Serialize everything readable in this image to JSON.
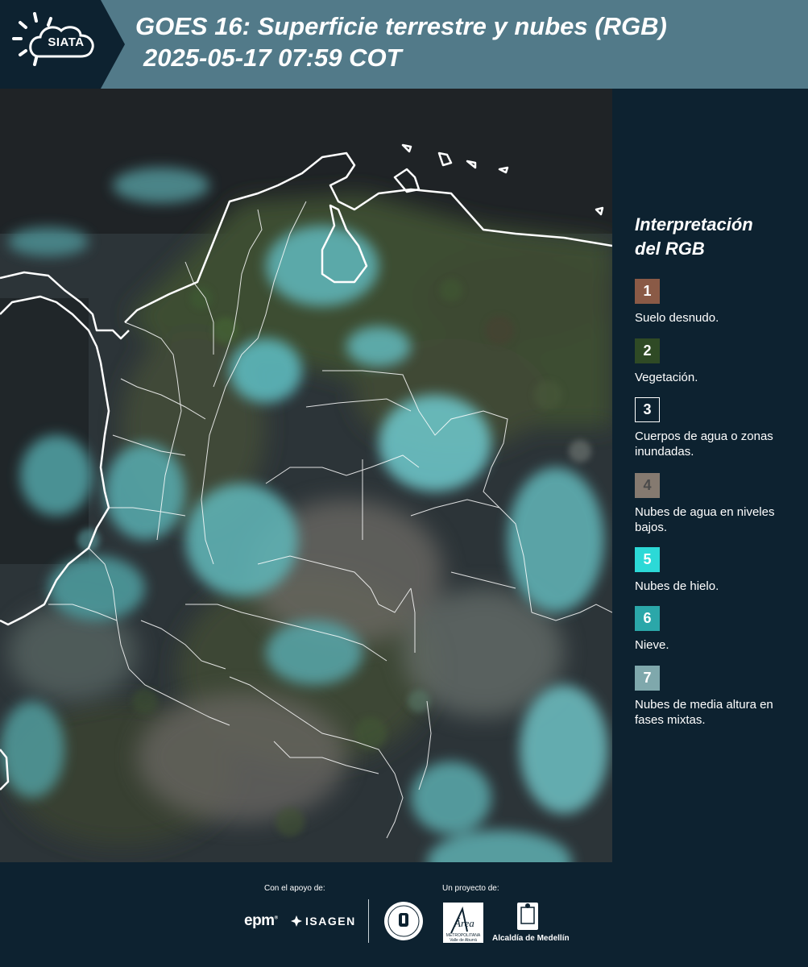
{
  "header": {
    "logo_text": "SIATA",
    "title": "GOES 16: Superficie terrestre y nubes (RGB)",
    "subtitle": "2025-05-17 07:59 COT"
  },
  "map": {
    "description_icon": "satellite-rgb-image"
  },
  "legend": {
    "title_line1": "Interpretación",
    "title_line2": "del RGB",
    "items": [
      {
        "number": "1",
        "label": "Suelo desnudo.",
        "color": "#8a5a46"
      },
      {
        "number": "2",
        "label": "Vegetación.",
        "color": "#2f4a25"
      },
      {
        "number": "3",
        "label": "Cuerpos de agua o zonas inundadas.",
        "color": "#0d2230"
      },
      {
        "number": "4",
        "label": "Nubes de agua en niveles bajos.",
        "color": "#857a70"
      },
      {
        "number": "5",
        "label": "Nubes de hielo.",
        "color": "#2cd9d7"
      },
      {
        "number": "6",
        "label": "Nieve.",
        "color": "#2ba7a9"
      },
      {
        "number": "7",
        "label": "Nubes de media altura en fases mixtas.",
        "color": "#7fa8ac"
      }
    ]
  },
  "footer": {
    "support_label": "Con el apoyo de:",
    "project_label": "Un proyecto de:",
    "epm": "epm",
    "isagen": "ISAGEN",
    "area_metropolitana": "Área",
    "area_sub": "METROPOLITANA Valle de Aburrá",
    "alcaldia": "Alcaldía de Medellín"
  }
}
